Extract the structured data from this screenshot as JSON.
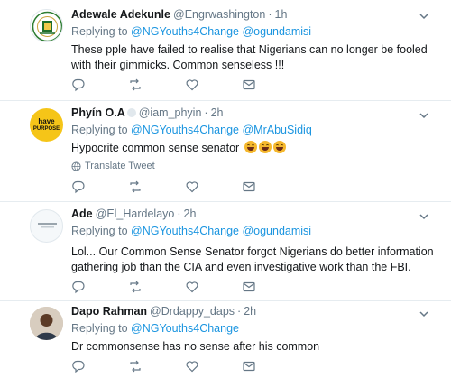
{
  "tweets": [
    {
      "name": "Adewale Adekunle",
      "handle": "@Engrwashington",
      "separator": "·",
      "time": "1h",
      "replying_prefix": "Replying to",
      "mentions": [
        "@NGYouths4Change",
        "@ogundamisi"
      ],
      "text": "These pple have failed to realise that Nigerians can no longer be fooled with their gimmicks. Common senseless !!!",
      "avatar": "nigerian-senate-seal-avatar"
    },
    {
      "name": "Phyín O.A",
      "handle": "@iam_phyin",
      "separator": "·",
      "time": "2h",
      "replying_prefix": "Replying to",
      "mentions": [
        "@NGYouths4Change",
        "@MrAbuSidiq"
      ],
      "text": "Hypocrite common sense senator",
      "emoji_count": 3,
      "translate_label": "Translate Tweet",
      "avatar": "have-purpose-avatar",
      "avatar_text_1": "have",
      "avatar_text_2": "PURPOSE"
    },
    {
      "name": "Ade",
      "handle": "@El_Hardelayo",
      "separator": "·",
      "time": "2h",
      "replying_prefix": "Replying to",
      "mentions": [
        "@NGYouths4Change",
        "@ogundamisi"
      ],
      "text": "Lol... Our Common Sense Senator forgot Nigerians do better information gathering job than the CIA and even investigative work than the FBI.",
      "avatar": "placeholder-avatar"
    },
    {
      "name": "Dapo Rahman",
      "handle": "@Drdappy_daps",
      "separator": "·",
      "time": "2h",
      "replying_prefix": "Replying to",
      "mentions": [
        "@NGYouths4Change"
      ],
      "text": "Dr commonsense has no sense after his common",
      "avatar": "photo-avatar"
    }
  ],
  "colors": {
    "link": "#1b95e0",
    "secondary": "#657786",
    "primary": "#14171a",
    "divider": "#e6ecf0"
  },
  "icons": [
    "reply-icon",
    "retweet-icon",
    "like-icon",
    "direct-message-icon",
    "caret-down-icon",
    "translate-globe-icon"
  ]
}
